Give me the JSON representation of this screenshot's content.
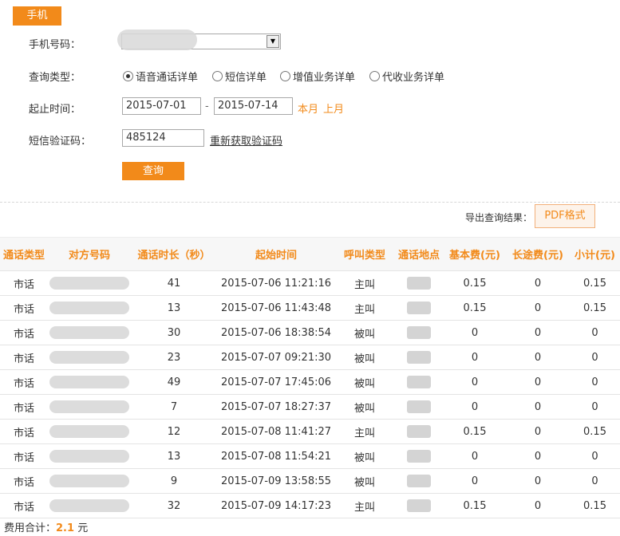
{
  "tab": {
    "label": "手机"
  },
  "form": {
    "phone_label": "手机号码：",
    "query_type_label": "查询类型：",
    "query_types": [
      "语音通话详单",
      "短信详单",
      "增值业务详单",
      "代收业务详单"
    ],
    "selected_query_type": "语音通话详单",
    "date_label": "起止时间：",
    "start_date": "2015-07-01",
    "date_sep": "-",
    "end_date": "2015-07-14",
    "this_month": "本月",
    "last_month": "上月",
    "sms_label": "短信验证码：",
    "sms_code": "485124",
    "resend_link": "重新获取验证码",
    "submit": "查询"
  },
  "export": {
    "label": "导出查询结果：",
    "pdf": "PDF格式"
  },
  "table": {
    "headers": [
      "通话类型",
      "对方号码",
      "通话时长（秒）",
      "起始时间",
      "呼叫类型",
      "通话地点",
      "基本费(元)",
      "长途费(元)",
      "小计(元)"
    ],
    "rows": [
      [
        "市话",
        "",
        "41",
        "2015-07-06 11:21:16",
        "主叫",
        "",
        "0.15",
        "0",
        "0.15"
      ],
      [
        "市话",
        "",
        "13",
        "2015-07-06 11:43:48",
        "主叫",
        "",
        "0.15",
        "0",
        "0.15"
      ],
      [
        "市话",
        "",
        "30",
        "2015-07-06 18:38:54",
        "被叫",
        "",
        "0",
        "0",
        "0"
      ],
      [
        "市话",
        "",
        "23",
        "2015-07-07 09:21:30",
        "被叫",
        "",
        "0",
        "0",
        "0"
      ],
      [
        "市话",
        "",
        "49",
        "2015-07-07 17:45:06",
        "被叫",
        "",
        "0",
        "0",
        "0"
      ],
      [
        "市话",
        "",
        "7",
        "2015-07-07 18:27:37",
        "被叫",
        "",
        "0",
        "0",
        "0"
      ],
      [
        "市话",
        "",
        "12",
        "2015-07-08 11:41:27",
        "主叫",
        "",
        "0.15",
        "0",
        "0.15"
      ],
      [
        "市话",
        "",
        "13",
        "2015-07-08 11:54:21",
        "被叫",
        "",
        "0",
        "0",
        "0"
      ],
      [
        "市话",
        "",
        "9",
        "2015-07-09 13:58:55",
        "被叫",
        "",
        "0",
        "0",
        "0"
      ],
      [
        "市话",
        "",
        "32",
        "2015-07-09 14:17:23",
        "主叫",
        "",
        "0.15",
        "0",
        "0.15"
      ]
    ]
  },
  "footer": {
    "label": "费用合计：",
    "amount": "2.1",
    "unit": "元"
  },
  "colors": {
    "accent": "#f28a1a"
  }
}
